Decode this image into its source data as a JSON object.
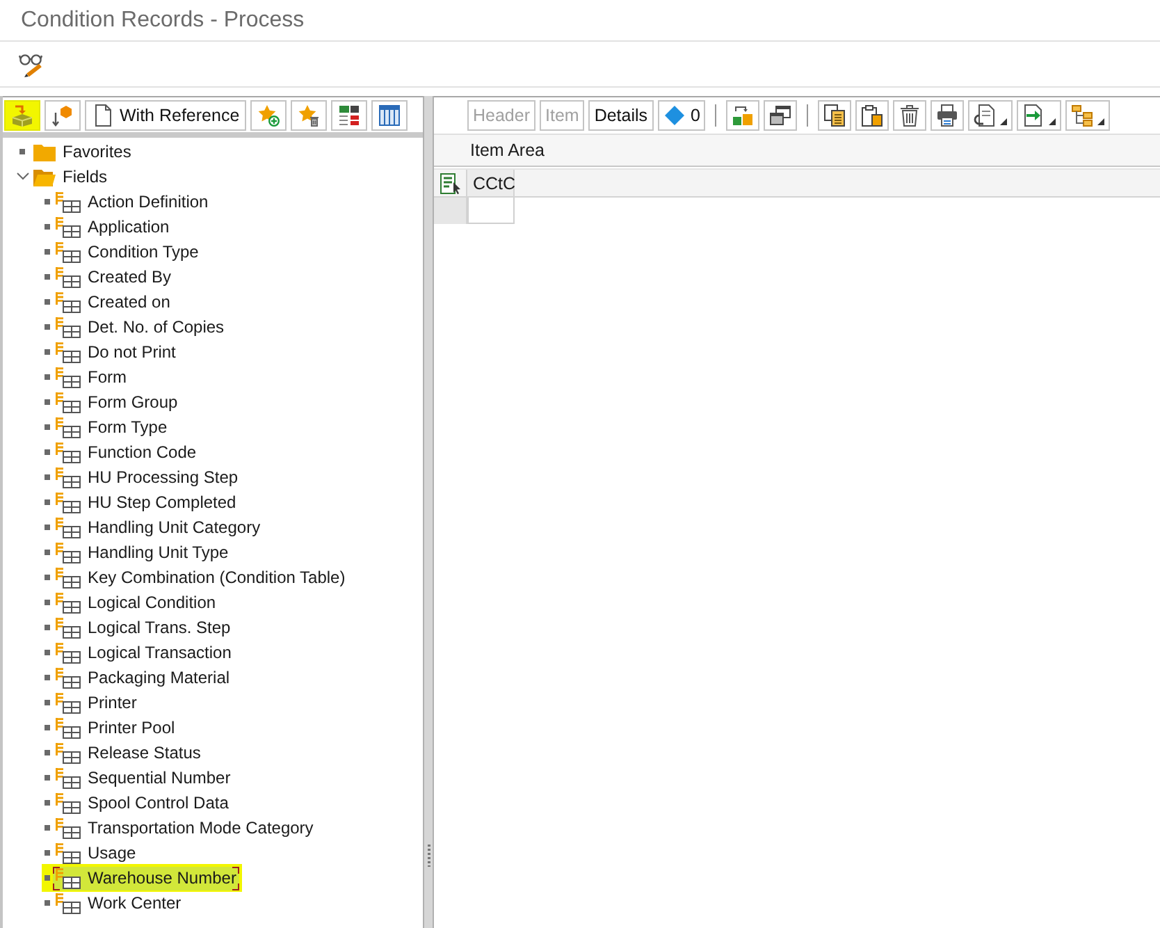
{
  "window": {
    "title": "Condition Records - Process"
  },
  "left_toolbar": {
    "buttons": [
      {
        "kind": "icon",
        "highlighted": true
      },
      {
        "kind": "icon",
        "highlighted": false
      },
      {
        "kind": "text",
        "label": "With Reference",
        "highlighted": false
      },
      {
        "kind": "icon",
        "highlighted": false
      },
      {
        "kind": "icon",
        "highlighted": false
      },
      {
        "kind": "icon",
        "highlighted": false
      },
      {
        "kind": "icon",
        "highlighted": false
      }
    ]
  },
  "tree": [
    {
      "label": "Favorites",
      "kind": "folder",
      "expanded": false,
      "selected": false,
      "highlighted": false
    },
    {
      "label": "Fields",
      "kind": "folder",
      "expanded": true,
      "selected": false,
      "highlighted": false,
      "children": [
        {
          "label": "Action Definition",
          "kind": "field",
          "selected": false,
          "highlighted": false
        },
        {
          "label": "Application",
          "kind": "field",
          "selected": false,
          "highlighted": false
        },
        {
          "label": "Condition Type",
          "kind": "field",
          "selected": false,
          "highlighted": false
        },
        {
          "label": "Created By",
          "kind": "field",
          "selected": false,
          "highlighted": false
        },
        {
          "label": "Created on",
          "kind": "field",
          "selected": false,
          "highlighted": false
        },
        {
          "label": "Det. No. of Copies",
          "kind": "field",
          "selected": false,
          "highlighted": false
        },
        {
          "label": "Do not Print",
          "kind": "field",
          "selected": false,
          "highlighted": false
        },
        {
          "label": "Form",
          "kind": "field",
          "selected": false,
          "highlighted": false
        },
        {
          "label": "Form Group",
          "kind": "field",
          "selected": false,
          "highlighted": false
        },
        {
          "label": "Form Type",
          "kind": "field",
          "selected": false,
          "highlighted": false
        },
        {
          "label": "Function Code",
          "kind": "field",
          "selected": false,
          "highlighted": false
        },
        {
          "label": "HU Processing Step",
          "kind": "field",
          "selected": false,
          "highlighted": false
        },
        {
          "label": "HU Step Completed",
          "kind": "field",
          "selected": false,
          "highlighted": false
        },
        {
          "label": "Handling Unit Category",
          "kind": "field",
          "selected": false,
          "highlighted": false
        },
        {
          "label": "Handling Unit Type",
          "kind": "field",
          "selected": false,
          "highlighted": false
        },
        {
          "label": "Key Combination (Condition Table)",
          "kind": "field",
          "selected": false,
          "highlighted": false
        },
        {
          "label": "Logical Condition",
          "kind": "field",
          "selected": false,
          "highlighted": false
        },
        {
          "label": "Logical Trans. Step",
          "kind": "field",
          "selected": false,
          "highlighted": false
        },
        {
          "label": "Logical Transaction",
          "kind": "field",
          "selected": false,
          "highlighted": false
        },
        {
          "label": "Packaging Material",
          "kind": "field",
          "selected": false,
          "highlighted": false
        },
        {
          "label": "Printer",
          "kind": "field",
          "selected": false,
          "highlighted": false
        },
        {
          "label": "Printer Pool",
          "kind": "field",
          "selected": false,
          "highlighted": false
        },
        {
          "label": "Release Status",
          "kind": "field",
          "selected": false,
          "highlighted": false
        },
        {
          "label": "Sequential Number",
          "kind": "field",
          "selected": false,
          "highlighted": false
        },
        {
          "label": "Spool Control Data",
          "kind": "field",
          "selected": false,
          "highlighted": false
        },
        {
          "label": "Transportation Mode Category",
          "kind": "field",
          "selected": false,
          "highlighted": false
        },
        {
          "label": "Usage",
          "kind": "field",
          "selected": false,
          "highlighted": false
        },
        {
          "label": "Warehouse Number",
          "kind": "field",
          "selected": true,
          "highlighted": true
        },
        {
          "label": "Work Center",
          "kind": "field",
          "selected": false,
          "highlighted": false
        }
      ]
    }
  ],
  "right_toolbar": {
    "buttons": [
      {
        "kind": "text",
        "label": "Header",
        "disabled": true
      },
      {
        "kind": "text",
        "label": "Item",
        "disabled": true
      },
      {
        "kind": "text",
        "label": "Details",
        "disabled": false
      },
      {
        "kind": "counter",
        "label": "0"
      },
      {
        "kind": "separator"
      },
      {
        "kind": "icon",
        "dropdown": false
      },
      {
        "kind": "icon",
        "dropdown": false
      },
      {
        "kind": "separator"
      },
      {
        "kind": "icon",
        "dropdown": false
      },
      {
        "kind": "icon",
        "dropdown": false
      },
      {
        "kind": "icon",
        "dropdown": false
      },
      {
        "kind": "icon",
        "dropdown": false
      },
      {
        "kind": "icon",
        "dropdown": true
      },
      {
        "kind": "icon",
        "dropdown": true
      },
      {
        "kind": "icon",
        "dropdown": true
      }
    ]
  },
  "item_area": {
    "title": "Item Area",
    "columns": [
      "CCtC"
    ]
  }
}
